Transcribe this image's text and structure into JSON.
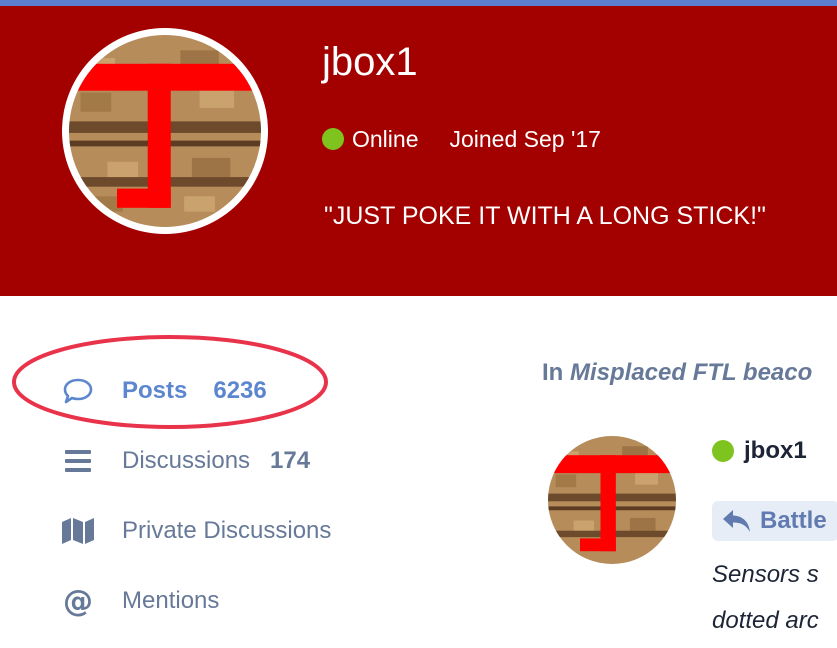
{
  "profile": {
    "username": "jbox1",
    "status": "Online",
    "joined": "Joined Sep '17",
    "bio": "\"JUST POKE IT WITH A LONG STICK!\"",
    "status_color": "#7fc31f",
    "banner_color": "#a30000"
  },
  "nav": {
    "items": [
      {
        "label": "Posts",
        "count": "6236",
        "icon": "comment-icon",
        "active": true
      },
      {
        "label": "Discussions",
        "count": "174",
        "icon": "list-icon"
      },
      {
        "label": "Private Discussions",
        "icon": "map-icon"
      },
      {
        "label": "Mentions",
        "icon": "at-icon"
      }
    ],
    "highlight_color": "#e8334a"
  },
  "post": {
    "thread_prefix": "In",
    "thread_title": "Misplaced FTL beaco",
    "username": "jbox1",
    "reply_label": "Battle",
    "snippet_lines": [
      "Sensors s",
      "dotted arc"
    ]
  }
}
